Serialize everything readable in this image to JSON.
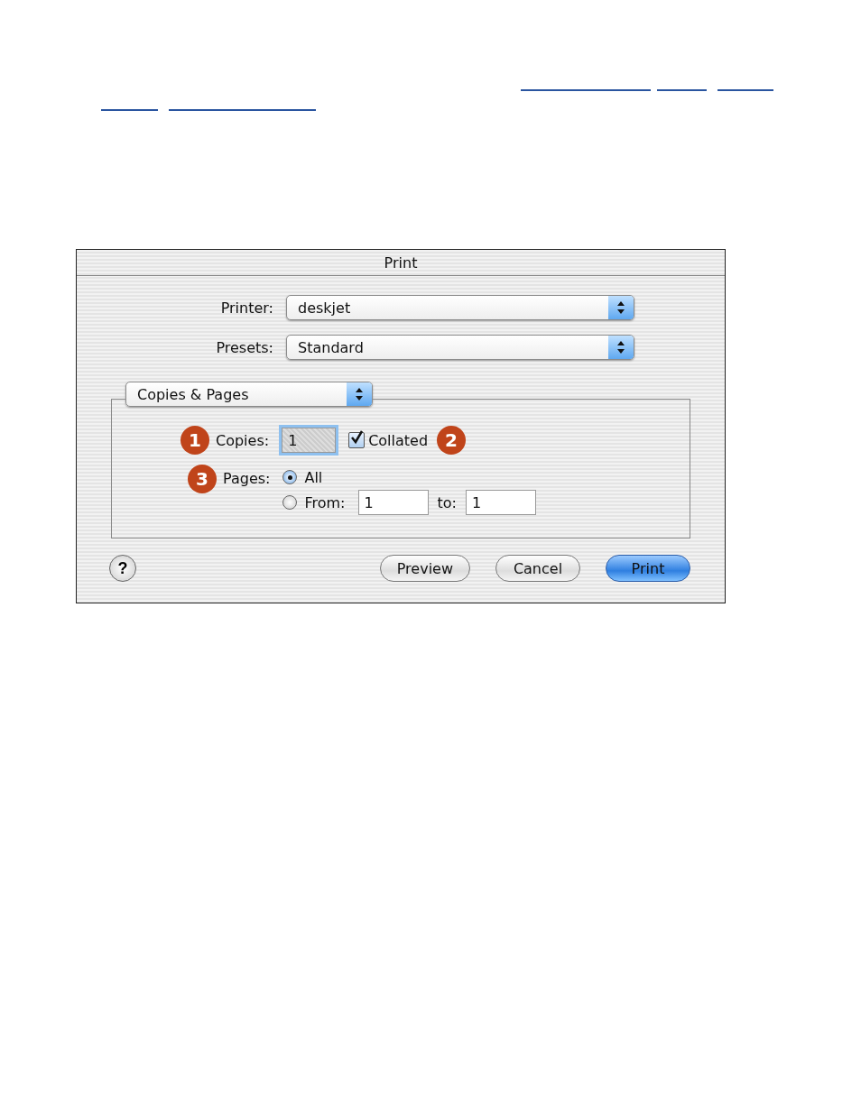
{
  "window": {
    "title": "Print"
  },
  "printer": {
    "label": "Printer:",
    "value": "deskjet"
  },
  "presets": {
    "label": "Presets:",
    "value": "Standard"
  },
  "panel_menu": {
    "value": "Copies & Pages"
  },
  "copies": {
    "callout": "1",
    "label": "Copies:",
    "value": "1"
  },
  "collated": {
    "label": "Collated",
    "checked": true,
    "callout": "2"
  },
  "pages": {
    "callout": "3",
    "label": "Pages:",
    "options": [
      {
        "label": "All",
        "selected": true
      },
      {
        "label": "From:",
        "selected": false
      }
    ],
    "from": "1",
    "to_label": "to:",
    "to": "1"
  },
  "help": "?",
  "buttons": [
    {
      "label": "Preview",
      "default": false
    },
    {
      "label": "Cancel",
      "default": false
    },
    {
      "label": "Print",
      "default": true
    }
  ]
}
